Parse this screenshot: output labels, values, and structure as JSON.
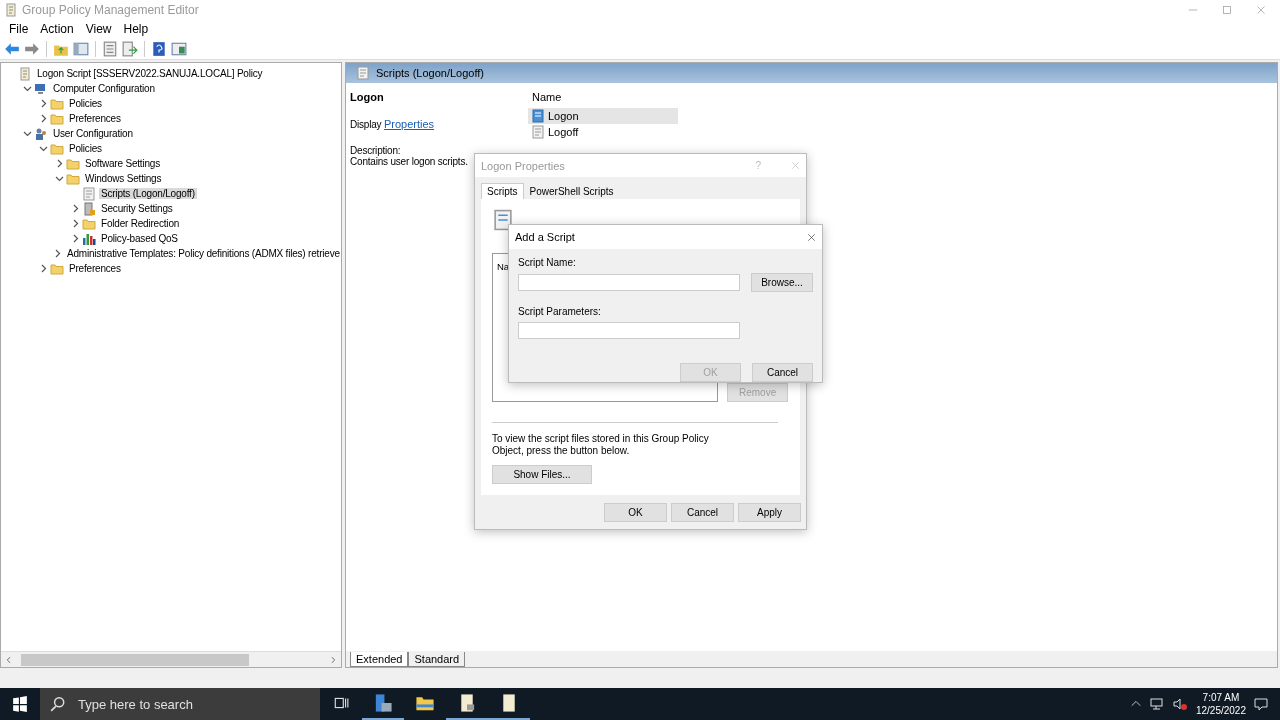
{
  "window": {
    "title": "Group Policy Management Editor"
  },
  "menu": [
    "File",
    "Action",
    "View",
    "Help"
  ],
  "tree": {
    "label": "Logon Script [SSSERV2022.SANUJA.LOCAL] Policy",
    "kind": "scroll",
    "selected": false,
    "children": [
      {
        "label": "Computer Configuration",
        "kind": "computer",
        "selected": false,
        "expanded": true,
        "children": [
          {
            "label": "Policies",
            "kind": "folder",
            "selected": false,
            "expanded": false
          },
          {
            "label": "Preferences",
            "kind": "folder",
            "selected": false,
            "expanded": false
          }
        ]
      },
      {
        "label": "User Configuration",
        "kind": "users",
        "selected": false,
        "expanded": true,
        "children": [
          {
            "label": "Policies",
            "kind": "folder",
            "selected": false,
            "expanded": true,
            "children": [
              {
                "label": "Software Settings",
                "kind": "folder",
                "selected": false,
                "expanded": false
              },
              {
                "label": "Windows Settings",
                "kind": "folder",
                "selected": false,
                "expanded": true,
                "children": [
                  {
                    "label": "Scripts (Logon/Logoff)",
                    "kind": "script",
                    "selected": true
                  },
                  {
                    "label": "Security Settings",
                    "kind": "security",
                    "selected": false,
                    "expanded": false
                  },
                  {
                    "label": "Folder Redirection",
                    "kind": "folder",
                    "selected": false,
                    "expanded": false
                  },
                  {
                    "label": "Policy-based QoS",
                    "kind": "chart",
                    "selected": false,
                    "expanded": false
                  }
                ]
              },
              {
                "label": "Administrative Templates: Policy definitions (ADMX files) retrieve",
                "kind": "folder",
                "selected": false,
                "expanded": false
              }
            ]
          },
          {
            "label": "Preferences",
            "kind": "folder",
            "selected": false,
            "expanded": false
          }
        ]
      }
    ]
  },
  "details": {
    "header": "Scripts (Logon/Logoff)",
    "heading": "Logon",
    "display_text": "Display",
    "display_link": "Properties",
    "description_label": "Description:",
    "description": "Contains user logon scripts.",
    "list_column": "Name",
    "items": [
      {
        "label": "Logon",
        "selected": true,
        "kind": "script-blue"
      },
      {
        "label": "Logoff",
        "selected": false,
        "kind": "script"
      }
    ]
  },
  "view_tabs": [
    {
      "label": "Extended",
      "selected": true
    },
    {
      "label": "Standard",
      "selected": false
    }
  ],
  "logon_properties": {
    "title": "Logon Properties",
    "help": "?",
    "tabs": [
      {
        "label": "Scripts",
        "selected": true
      },
      {
        "label": "PowerShell Scripts",
        "selected": false
      }
    ],
    "list_column": "Na",
    "remove_button": {
      "label": "Remove",
      "disabled": true
    },
    "note": "To view the script files stored in this Group Policy Object, press the button below.",
    "show_files": "Show Files...",
    "buttons": [
      {
        "label": "OK",
        "disabled": false
      },
      {
        "label": "Cancel",
        "disabled": false
      },
      {
        "label": "Apply",
        "disabled": false
      }
    ]
  },
  "add_script": {
    "title": "Add a Script",
    "name_label": "Script Name:",
    "browse": "Browse...",
    "params_label": "Script Parameters:",
    "buttons": [
      {
        "label": "OK",
        "disabled": true
      },
      {
        "label": "Cancel",
        "disabled": false
      }
    ]
  },
  "taskbar": {
    "search_placeholder": "Type here to search",
    "time": "7:07 AM",
    "date": "12/25/2022"
  }
}
